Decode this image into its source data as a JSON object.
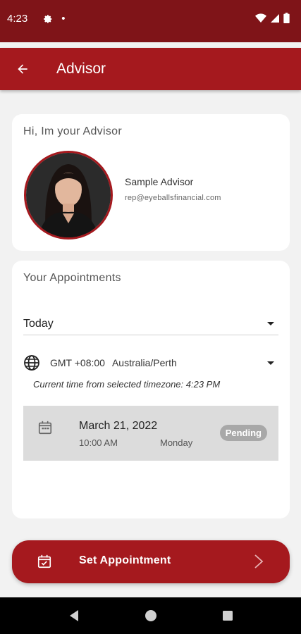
{
  "status_bar": {
    "time": "4:23",
    "dot": "•"
  },
  "app_bar": {
    "title": "Advisor"
  },
  "advisor": {
    "heading": "Hi, Im your Advisor",
    "name": "Sample Advisor",
    "email": "rep@eyeballsfinancial.com"
  },
  "appointments": {
    "heading": "Your Appointments",
    "filter_selected": "Today",
    "timezone_offset": "GMT +08:00",
    "timezone_name": "Australia/Perth",
    "current_time_text": "Current time from selected timezone: 4:23 PM",
    "items": [
      {
        "date": "March 21, 2022",
        "time": "10:00 AM",
        "day": "Monday",
        "status": "Pending"
      }
    ]
  },
  "set_appointment_label": "Set Appointment",
  "colors": {
    "brand": "#a5191e",
    "status_bar": "#7f1418",
    "badge": "#a8a8a8"
  }
}
